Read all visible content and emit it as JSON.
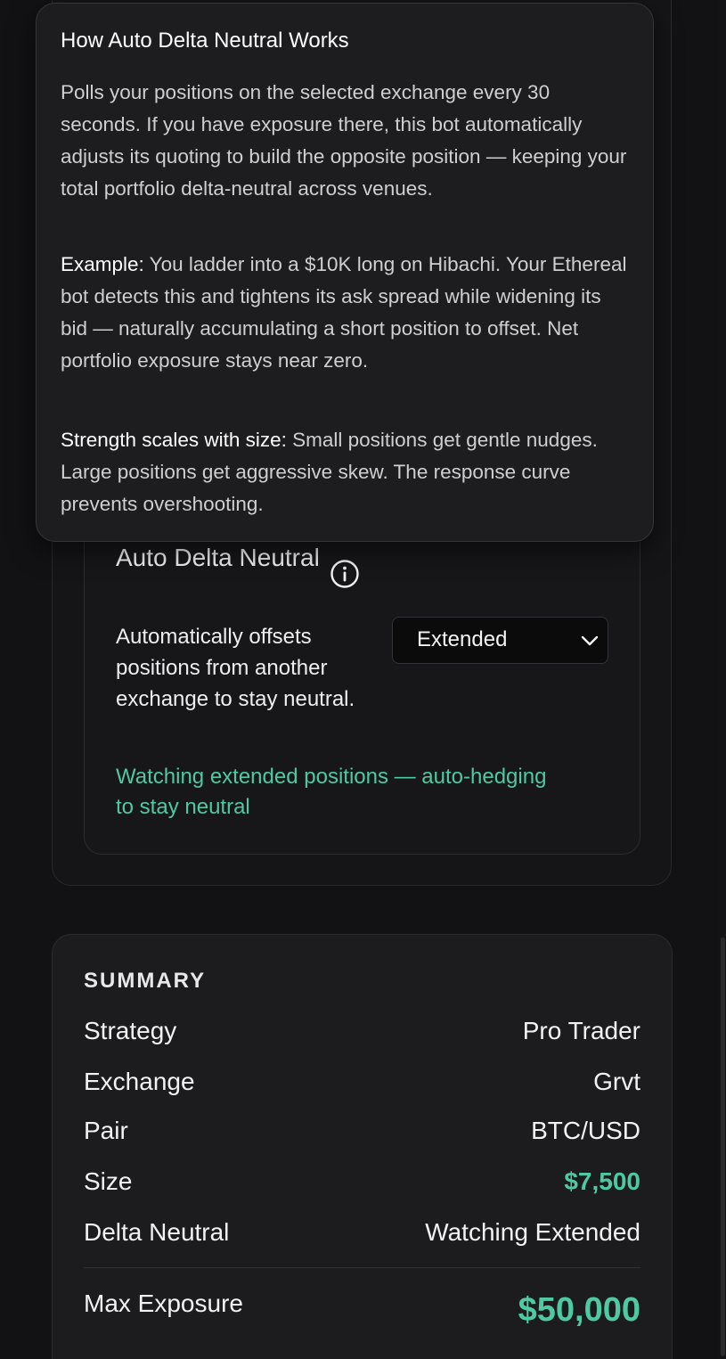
{
  "tooltip": {
    "title": "How Auto Delta Neutral Works",
    "paragraph1": "Polls your positions on the selected exchange every 30 seconds. If you have exposure there, this bot automatically adjusts its quoting to build the opposite position — keeping your total portfolio delta-neutral across venues.",
    "example_label": "Example:",
    "example_text": " You ladder into a $10K long on Hibachi. Your Ethereal bot detects this and tightens its ask spread while widening its bid — naturally accumulating a short position to offset. Net portfolio exposure stays near zero.",
    "strength_label": "Strength scales with size:",
    "strength_text": " Small positions get gentle nudges. Large positions get aggressive skew. The response curve prevents overshooting."
  },
  "setting": {
    "title": "Auto Delta Neutral",
    "description": "Automatically offsets positions from another exchange to stay neutral.",
    "info_icon": "info-circle-icon",
    "select_value": "Extended",
    "status": "Watching extended positions — auto-hedging to stay neutral"
  },
  "summary": {
    "heading": "SUMMARY",
    "rows": [
      {
        "label": "Strategy",
        "value": "Pro Trader"
      },
      {
        "label": "Exchange",
        "value": "Grvt"
      },
      {
        "label": "Pair",
        "value": "BTC/USD"
      },
      {
        "label": "Size",
        "value": "$7,500"
      },
      {
        "label": "Delta Neutral",
        "value": "Watching Extended"
      }
    ],
    "max_label": "Max Exposure",
    "max_value": "$50,000"
  },
  "colors": {
    "accent": "#4ec9a0",
    "background": "#121214",
    "card": "#1c1c1f"
  }
}
